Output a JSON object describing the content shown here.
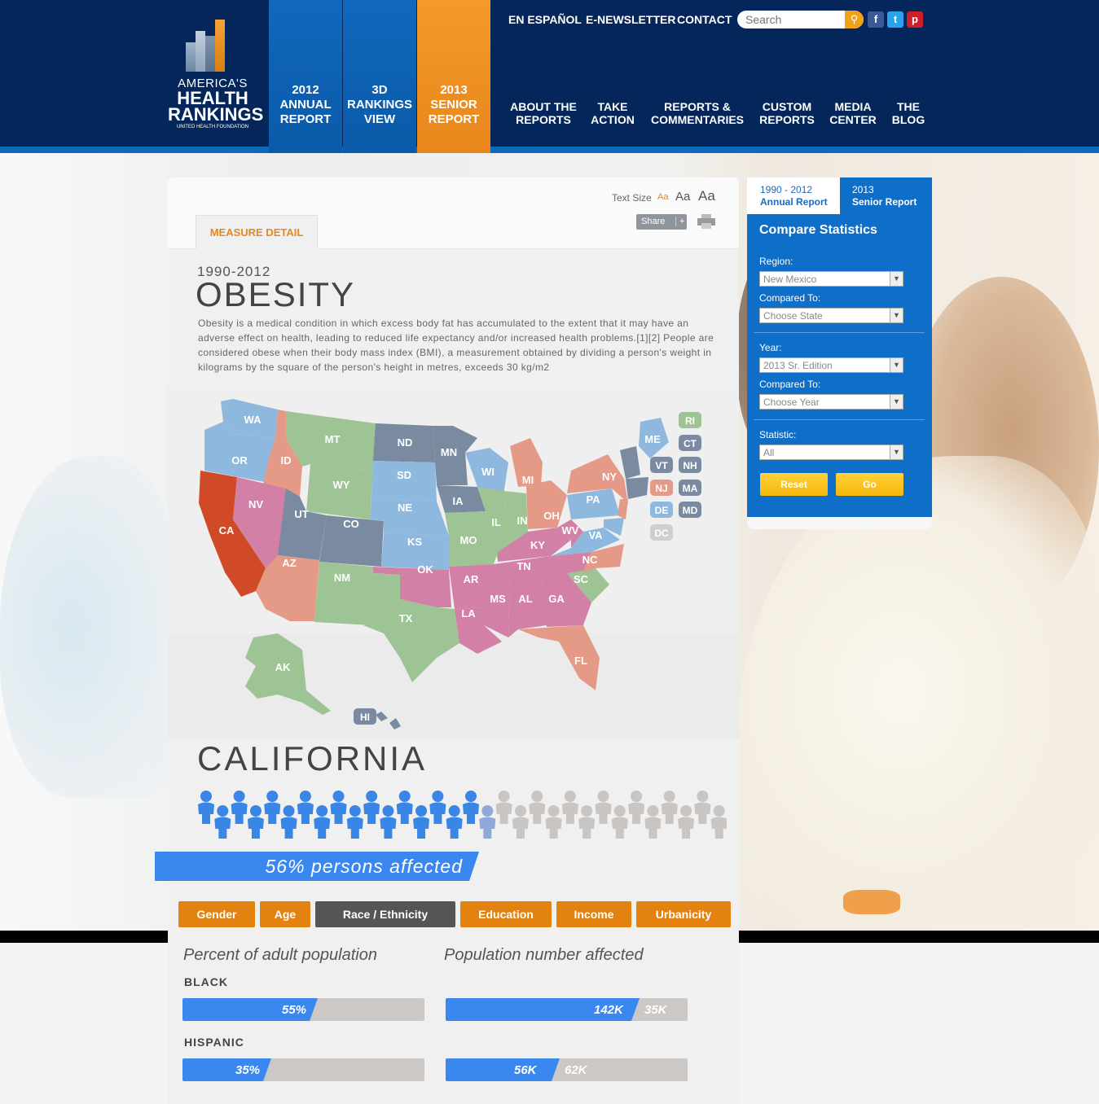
{
  "header": {
    "logo": {
      "line1": "AMERICA'S",
      "line2": "HEALTH",
      "line3": "RANKINGS",
      "line4": "UNITED HEALTH FOUNDATION"
    },
    "tabs": [
      {
        "label_top": "2012",
        "label_mid": "ANNUAL",
        "label_bot": "REPORT"
      },
      {
        "label_top": "3D",
        "label_mid": "RANKINGS",
        "label_bot": "VIEW"
      },
      {
        "label_top": "2013",
        "label_mid": "SENIOR",
        "label_bot": "REPORT"
      }
    ],
    "top_links": [
      "EN ESPAÑOL",
      "E-NEWSLETTER",
      "CONTACT"
    ],
    "search_placeholder": "Search",
    "social": [
      "f",
      "t",
      "p"
    ],
    "nav": [
      {
        "l1": "ABOUT THE",
        "l2": "REPORTS"
      },
      {
        "l1": "TAKE",
        "l2": "ACTION"
      },
      {
        "l1": "REPORTS &",
        "l2": "COMMENTARIES"
      },
      {
        "l1": "CUSTOM",
        "l2": "REPORTS"
      },
      {
        "l1": "MEDIA",
        "l2": "CENTER"
      },
      {
        "l1": "THE",
        "l2": "BLOG"
      }
    ],
    "colors": {
      "navy": "#04265a",
      "blue": "#1168bd",
      "orange": "#f39a2a"
    }
  },
  "toolbar": {
    "text_size_label": "Text Size",
    "sizes": [
      "Aa",
      "Aa",
      "Aa"
    ],
    "share": "Share",
    "share_plus": "+"
  },
  "measure_tab": "MEASURE DETAIL",
  "measure": {
    "years": "1990-2012",
    "name": "OBESITY",
    "description": "Obesity is a medical condition in which excess body fat has accumulated to the extent that it may have an adverse effect on health, leading to reduced life expectancy and/or increased health problems.[1][2] People are considered obese when their body mass index (BMI), a measurement obtained by dividing a person's weight in kilograms by the square of the person's height in metres, exceeds 30 kg/m2"
  },
  "map": {
    "states": [
      "WA",
      "OR",
      "CA",
      "ID",
      "NV",
      "MT",
      "WY",
      "UT",
      "AZ",
      "CO",
      "NM",
      "ND",
      "SD",
      "NE",
      "KS",
      "OK",
      "TX",
      "MN",
      "IA",
      "MO",
      "AR",
      "LA",
      "WI",
      "IL",
      "MI",
      "IN",
      "KY",
      "TN",
      "MS",
      "AL",
      "OH",
      "WV",
      "VA",
      "NC",
      "SC",
      "GA",
      "FL",
      "PA",
      "NY",
      "ME",
      "AK",
      "HI"
    ],
    "small_states": [
      "RI",
      "CT",
      "VT",
      "NH",
      "NJ",
      "MA",
      "DE",
      "MD",
      "DC"
    ]
  },
  "state": {
    "name": "CALIFORNIA",
    "affected_text": "56% persons affected",
    "affected_fraction": 0.56,
    "people_count": 32
  },
  "filters": [
    "Gender",
    "Age",
    "Race / Ethnicity",
    "Education",
    "Income",
    "Urbanicity"
  ],
  "active_filter": "Race / Ethnicity",
  "stats": {
    "col1_title": "Percent of adult population",
    "col2_title": "Population number affected",
    "rows": [
      {
        "label": "BLACK",
        "pct_text": "55%",
        "pct": 0.55,
        "num_text": "142K",
        "rest_text": "35K",
        "num_fraction": 0.8
      },
      {
        "label": "HISPANIC",
        "pct_text": "35%",
        "pct": 0.35,
        "num_text": "56K",
        "rest_text": "62K",
        "num_fraction": 0.47
      }
    ]
  },
  "sidebar": {
    "tab1_l1": "1990 - 2012",
    "tab1_l2": "Annual Report",
    "tab2_l1": "2013",
    "tab2_l2": "Senior Report",
    "title": "Compare Statistics",
    "region_label": "Region:",
    "region_value": "New Mexico",
    "compared_to_label": "Compared To:",
    "compared_state_value": "Choose State",
    "year_label": "Year:",
    "year_value": "2013 Sr. Edition",
    "compared_to_label2": "Compared To:",
    "compared_year_value": "Choose Year",
    "statistic_label": "Statistic:",
    "statistic_value": "All",
    "reset": "Reset",
    "go": "Go"
  }
}
